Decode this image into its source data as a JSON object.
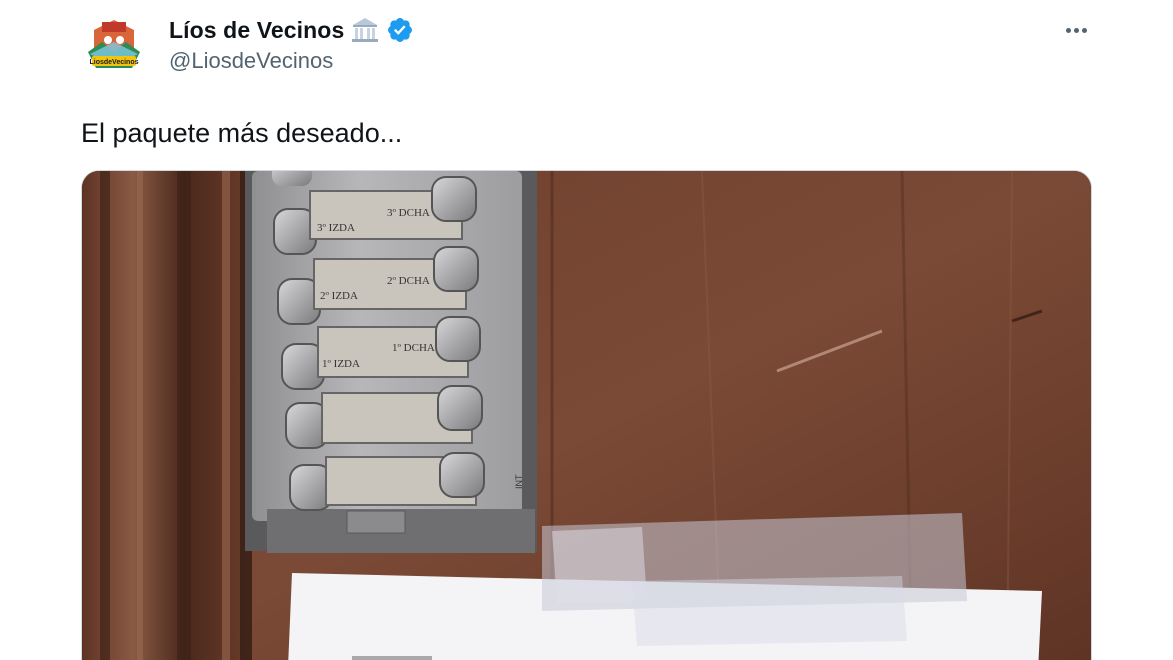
{
  "author": {
    "display_name": "Líos de Vecinos",
    "handle": "@LiosdeVecinos",
    "avatar_text": "LiosdeVecinos",
    "name_emoji": "classical-building-icon",
    "verified": "verified-badge-icon",
    "verified_color": "#1d9bf0"
  },
  "actions": {
    "more": "more-options-icon"
  },
  "tweet": {
    "text": "El paquete más deseado..."
  },
  "media": {
    "description_labels": {
      "row1_left": "3º IZDA",
      "row1_right": "3º DCHA",
      "row2_left": "2º IZDA",
      "row2_right": "2º DCHA",
      "row3_left": "1º IZDA",
      "row3_right": "1º DCHA"
    }
  },
  "colors": {
    "text_primary": "#0f1419",
    "text_secondary": "#536471",
    "wood": "#6b3c2a",
    "panel": "#a9a9ab"
  }
}
